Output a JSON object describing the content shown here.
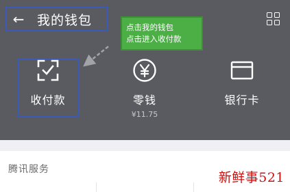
{
  "header": {
    "back_icon": "arrow-left-icon",
    "title": "我的钱包",
    "menu_icon": "grid-menu-icon"
  },
  "annotation": {
    "line1": "点击我的钱包",
    "line2": "点击进入收付款"
  },
  "actions": [
    {
      "label": "收付款",
      "icon": "scan-check-icon",
      "sub": ""
    },
    {
      "label": "零钱",
      "icon": "yen-coin-icon",
      "sub": "¥11.75"
    },
    {
      "label": "银行卡",
      "icon": "card-icon",
      "sub": ""
    }
  ],
  "services": {
    "title": "腾讯服务"
  },
  "watermark": "新鲜事521",
  "colors": {
    "header_bg": "#5a5b60",
    "highlight_border": "#3a5bb8",
    "callout_bg": "#4caf45",
    "watermark": "#cc1111"
  }
}
